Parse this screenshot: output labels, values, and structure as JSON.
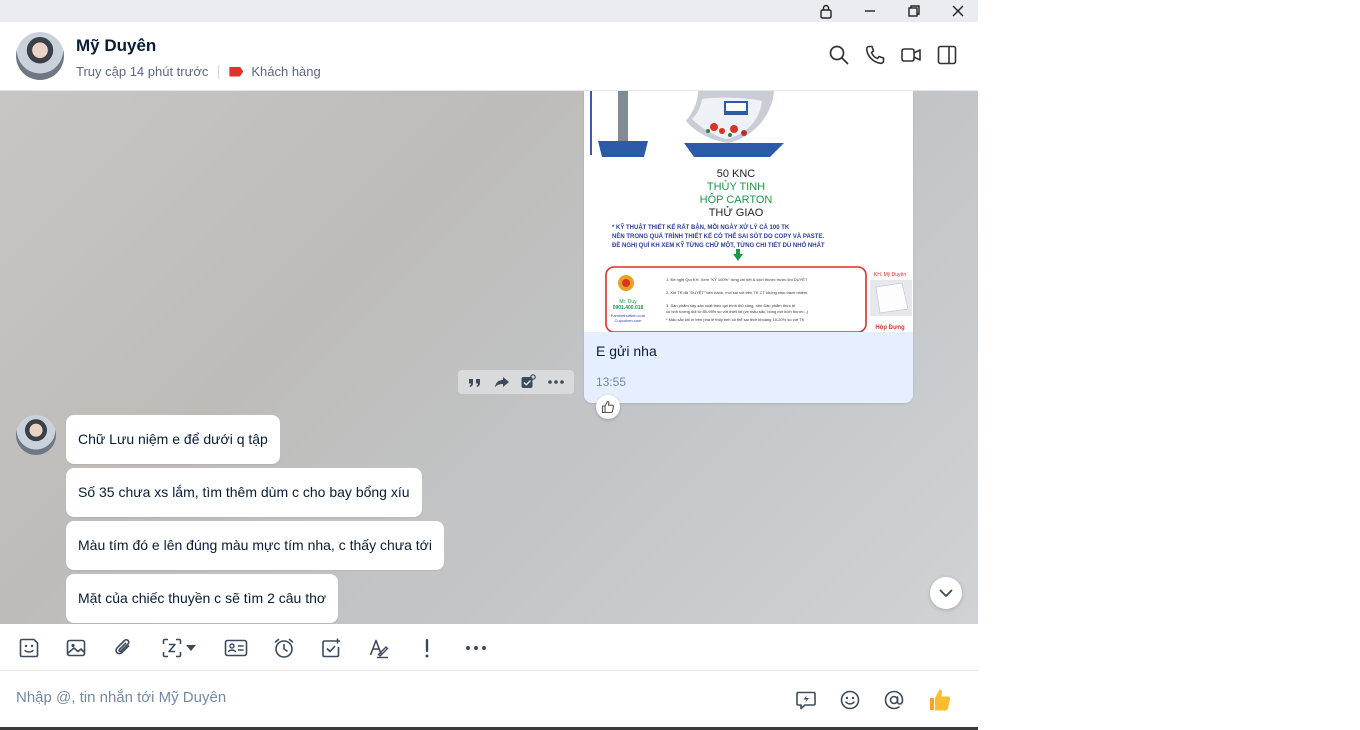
{
  "window": {
    "controls": [
      "lock-icon",
      "minimize-icon",
      "restore-icon",
      "close-icon"
    ]
  },
  "header": {
    "name": "Mỹ Duyên",
    "last_seen": "Truy cập 14 phút trước",
    "tag_label": "Khách hàng",
    "tag_color": "#db342e",
    "icons": [
      "search-icon",
      "phone-icon",
      "video-icon",
      "sidebar-toggle-icon"
    ]
  },
  "image_message": {
    "image_text": {
      "line1": "50 KNC",
      "line2": "THỦY TINH",
      "line3": "HỘP CARTON",
      "line4": "THỬ  GIAO",
      "note1": "* KỸ THUẬT THIẾT KẾ RẤT BẬN, MỖI NGÀY XỬ LÝ CẢ 100 TK",
      "note2": "NÊN TRONG QUÁ TRÌNH THIẾT KẾ CÓ THỂ SAI SÓT DO COPY VÀ PASTE.",
      "note3": "ĐỀ NGHỊ QUÍ KH XEM KỸ TỪNG CHỮ MỘT, TỪNG CHI TIẾT DÙ NHỎ NHẤT",
      "box_line1": "1. Đề nghị Quí KH. Xem  \"KỸ 100%\" từng chi tiết & kích thước trước khi DUYỆT",
      "box_line2": "2. Khi TK đã \"DUYỆT\" tiến hành, mọi sai sót trên TK CT không chịu trách nhiệm.",
      "box_line3": "3. Sản phẩm này sản xuất theo qui trình thủ công, nên Sản phẩm thực tế",
      "box_line4": "có tính tương đối từ 85-95% so với thiết kế (về màu sắc, bóng mờ kích thước...)",
      "box_line5": "* Màu sắc khi in trên pha lê thủy tinh có thể sai lệch khoảng 10-20% so với TK",
      "box_contact1": "Mr. Duy",
      "box_contact2": "0901.400.018",
      "box_contact3": "Famhethuttinh.com",
      "box_contact4": "Cupcuhen.com",
      "side_label_top": "KH. Mỹ Duyên",
      "side_label_bottom": "Hộp Đựng"
    },
    "caption": "E gửi nha",
    "time": "13:55"
  },
  "message_actions": [
    "quote-icon",
    "forward-icon",
    "add-task-icon",
    "more-icon"
  ],
  "incoming_messages": [
    "Chữ Lưu niệm e để dưới q tập",
    "Số 35 chưa xs lắm, tìm thêm dùm c cho bay bổng xíu",
    "Màu tím đó e lên đúng màu mực tím nha, c thấy chưa tới",
    "Mặt của chiếc thuyền c sẽ tìm 2 câu thơ"
  ],
  "toolbar": [
    "sticker-icon",
    "image-icon",
    "attachment-icon",
    "screenshot-icon",
    "dropdown-caret-icon",
    "contact-card-icon",
    "reminder-clock-icon",
    "task-icon",
    "format-text-icon",
    "urgent-icon",
    "more-icon"
  ],
  "composer": {
    "placeholder": "Nhập @, tin nhắn tới Mỹ Duyên",
    "icons": [
      "quick-reply-icon",
      "emoji-icon",
      "mention-icon",
      "thumbs-up-icon"
    ]
  }
}
